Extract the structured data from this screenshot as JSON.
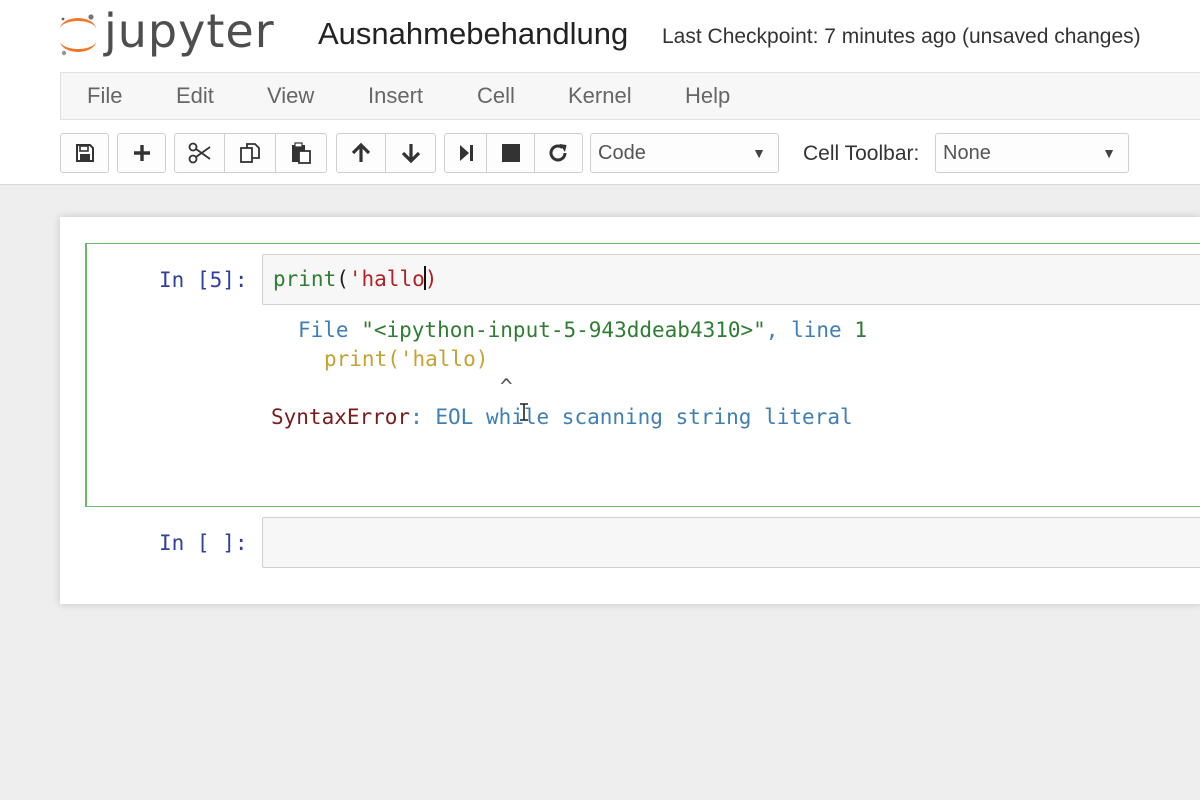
{
  "header": {
    "logo_text": "jupyter",
    "notebook_title": "Ausnahmebehandlung",
    "checkpoint": "Last Checkpoint: 7 minutes ago (unsaved changes)"
  },
  "menu": {
    "items": [
      "File",
      "Edit",
      "View",
      "Insert",
      "Cell",
      "Kernel",
      "Help"
    ]
  },
  "toolbar": {
    "buttons": [
      "save-icon",
      "plus-icon",
      "cut-icon",
      "copy-icon",
      "paste-icon",
      "arrow-up-icon",
      "arrow-down-icon",
      "run-icon",
      "stop-icon",
      "restart-icon"
    ],
    "cell_type_value": "Code",
    "cell_toolbar_label": "Cell Toolbar:",
    "cell_toolbar_value": "None"
  },
  "cells": [
    {
      "prompt": "In [5]:",
      "code": {
        "fn": "print",
        "open": "(",
        "string": "'hallo",
        "close": ")"
      },
      "output": {
        "file_kw": "File ",
        "file_path": "\"<ipython-input-5-943ddeab4310>\"",
        "comma_line": ", line ",
        "line_no": "1",
        "code_line": "print('hallo)",
        "caret": "^",
        "error_name": "SyntaxError",
        "error_colon": ":",
        "error_msg": " EOL while scanning string literal"
      }
    },
    {
      "prompt": "In [ ]:"
    }
  ],
  "colors": {
    "prompt": "#303f9f",
    "selected_border": "#66bb6a",
    "error_name": "#7b1a1a",
    "error_msg": "#3f7fb4",
    "string": "#b22222",
    "builtin": "#2e7d32"
  }
}
